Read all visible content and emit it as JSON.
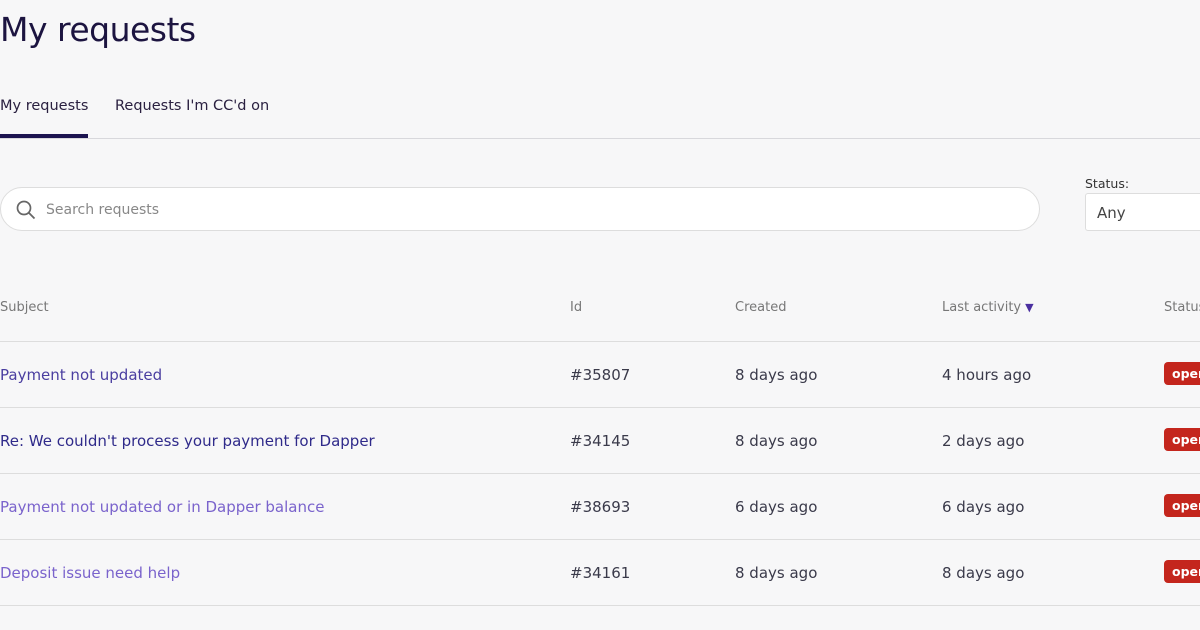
{
  "page": {
    "title": "My requests"
  },
  "tabs": [
    {
      "label": "My requests",
      "active": true
    },
    {
      "label": "Requests I'm CC'd on",
      "active": false
    }
  ],
  "search": {
    "placeholder": "Search requests",
    "value": "",
    "icon": "search-icon"
  },
  "status_filter": {
    "label": "Status:",
    "value": "Any"
  },
  "table": {
    "headers": {
      "subject": "Subject",
      "id": "Id",
      "created": "Created",
      "last_activity": "Last activity",
      "status": "Status"
    },
    "sort_icon": "▼",
    "rows": [
      {
        "subject": "Payment not updated",
        "id": "#35807",
        "created": "8 days ago",
        "last_activity": "4 hours ago",
        "status": "open",
        "link_color": "#4a3ea0"
      },
      {
        "subject": "Re: We couldn't process your payment for Dapper",
        "id": "#34145",
        "created": "8 days ago",
        "last_activity": "2 days ago",
        "status": "open",
        "link_color": "#2f2a8a"
      },
      {
        "subject": "Payment not updated or in Dapper balance",
        "id": "#38693",
        "created": "6 days ago",
        "last_activity": "6 days ago",
        "status": "open",
        "link_color": "#7a63cc"
      },
      {
        "subject": "Deposit issue need help",
        "id": "#34161",
        "created": "8 days ago",
        "last_activity": "8 days ago",
        "status": "open",
        "link_color": "#7a63cc"
      }
    ]
  },
  "colors": {
    "accent": "#1c1450",
    "status_open": "#c4261d"
  }
}
